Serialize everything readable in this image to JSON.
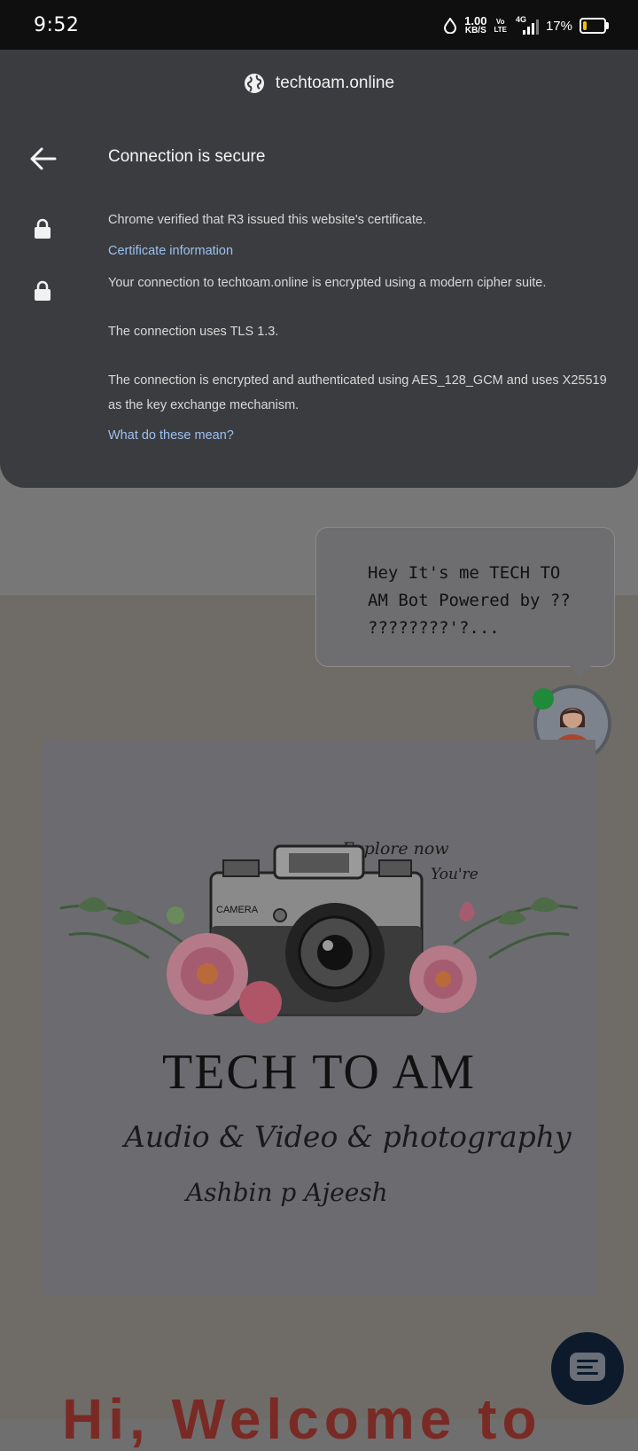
{
  "status_bar": {
    "time": "9:52",
    "data_speed_value": "1.00",
    "data_speed_unit": "KB/S",
    "volte_top": "Vo",
    "volte_bottom": "LTE",
    "network": "4G",
    "battery_percent": "17%",
    "battery_level": 0.17,
    "battery_color": "#f2c200"
  },
  "connection_sheet": {
    "site": "techtoam.online",
    "site_icon": "globe-icon",
    "back_icon": "back-arrow-icon",
    "title": "Connection is secure",
    "certificate_text": "Chrome verified that R3 issued this website's certificate.",
    "certificate_link": "Certificate information",
    "encryption_text": "Your connection to techtoam.online is encrypted using a modern cipher suite.",
    "tls_text": "The connection uses TLS 1.3.",
    "cipher_text": "The connection is encrypted and authenticated using AES_128_GCM and uses X25519 as the key exchange mechanism.",
    "help_link": "What do these mean?",
    "link_color": "#9cc0f0"
  },
  "chat_widget": {
    "message": "Hey It's me TECH TO AM Bot Powered by ?? ????????'?...",
    "online_status_color": "#1f8a3a",
    "fab_icon": "chat-lines-icon"
  },
  "logo": {
    "top_text_1": "Explore now",
    "top_text_2": "You're",
    "camera_label": "CAMERA",
    "title": "TECH TO AM",
    "subtitle": "Audio & Video & photography",
    "signature": "Ashbin p Ajeesh"
  },
  "page": {
    "heading_partial": "Hi, Welcome to"
  }
}
